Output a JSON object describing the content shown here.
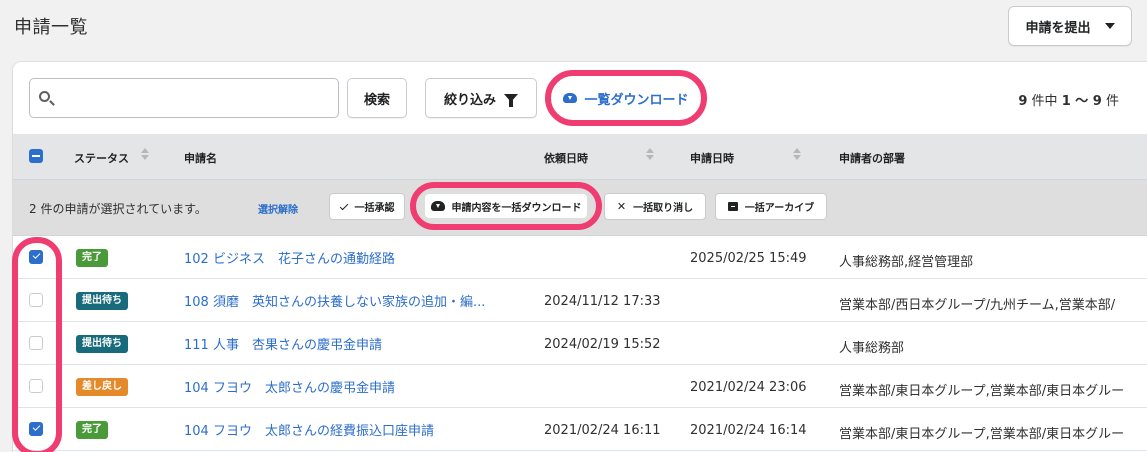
{
  "header": {
    "title": "申請一覧",
    "submit_button": "申請を提出"
  },
  "toolbar": {
    "search_placeholder": "",
    "search_button": "検索",
    "filter_button": "絞り込み",
    "download_link": "一覧ダウンロード",
    "count_total": "9",
    "count_unit": "件中",
    "count_range": "1 〜 9",
    "count_suffix": "件"
  },
  "table": {
    "columns": [
      "ステータス",
      "申請名",
      "依頼日時",
      "申請日時",
      "申請者の部署"
    ]
  },
  "bulk": {
    "selected_text": "2 件の申請が選択されています。",
    "deselect": "選択解除",
    "approve": "一括承認",
    "download": "申請内容を一括ダウンロード",
    "cancel": "一括取り消し",
    "archive": "一括アーカイブ"
  },
  "rows": [
    {
      "checked": true,
      "status": "完了",
      "status_color": "#4a9a3a",
      "title": "102 ビジネス　花子さんの通勤経路",
      "requested": "",
      "applied": "2025/02/25 15:49",
      "dept": "人事総務部,経営管理部"
    },
    {
      "checked": false,
      "status": "提出待ち",
      "status_color": "#176b7a",
      "title": "108 須磨　英知さんの扶養しない家族の追加・編...",
      "requested": "2024/11/12 17:33",
      "applied": "",
      "dept": "営業本部/西日本グループ/九州チーム,営業本部/"
    },
    {
      "checked": false,
      "status": "提出待ち",
      "status_color": "#176b7a",
      "title": "111 人事　杏果さんの慶弔金申請",
      "requested": "2024/02/19 15:52",
      "applied": "",
      "dept": "人事総務部"
    },
    {
      "checked": false,
      "status": "差し戻し",
      "status_color": "#e58a2b",
      "title": "104 フヨウ　太郎さんの慶弔金申請",
      "requested": "",
      "applied": "2021/02/24 23:06",
      "dept": "営業本部/東日本グループ,営業本部/東日本グルー"
    },
    {
      "checked": true,
      "status": "完了",
      "status_color": "#4a9a3a",
      "title": "104 フヨウ　太郎さんの経費振込口座申請",
      "requested": "2021/02/24 16:11",
      "applied": "2021/02/24 16:14",
      "dept": "営業本部/東日本グループ,営業本部/東日本グルー"
    }
  ],
  "colors": {
    "accent": "#2c6ecb",
    "highlight_ring": "#ef3d72"
  }
}
